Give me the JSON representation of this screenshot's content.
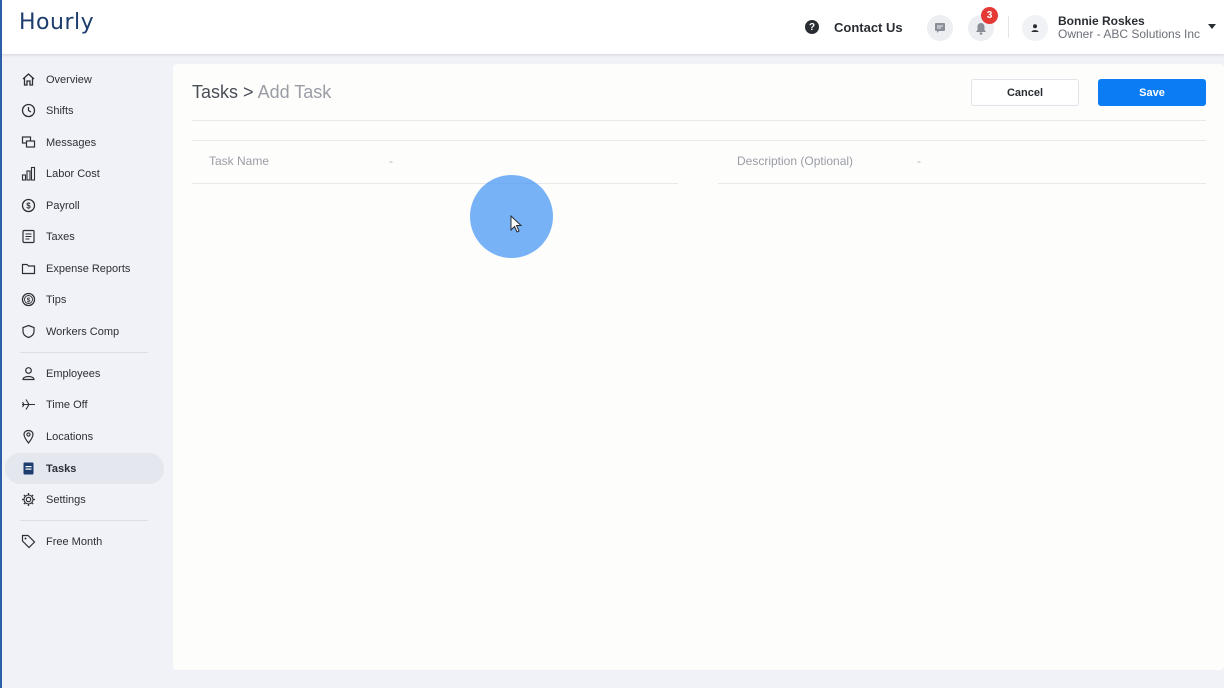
{
  "app": {
    "logo": "Hourly"
  },
  "header": {
    "contact_label": "Contact Us",
    "notification_count": "3",
    "user": {
      "name": "Bonnie Roskes",
      "role": "Owner - ABC Solutions Inc"
    }
  },
  "sidebar": {
    "items": [
      {
        "label": "Overview",
        "icon": "home-icon"
      },
      {
        "label": "Shifts",
        "icon": "clock-icon"
      },
      {
        "label": "Messages",
        "icon": "messages-icon"
      },
      {
        "label": "Labor Cost",
        "icon": "bar-chart-icon"
      },
      {
        "label": "Payroll",
        "icon": "dollar-icon"
      },
      {
        "label": "Taxes",
        "icon": "document-icon"
      },
      {
        "label": "Expense Reports",
        "icon": "folder-icon"
      },
      {
        "label": "Tips",
        "icon": "coin-icon"
      },
      {
        "label": "Workers Comp",
        "icon": "shield-icon"
      },
      {
        "label": "Employees",
        "icon": "person-icon"
      },
      {
        "label": "Time Off",
        "icon": "plane-icon"
      },
      {
        "label": "Locations",
        "icon": "location-pin-icon"
      },
      {
        "label": "Tasks",
        "icon": "book-icon",
        "active": true
      },
      {
        "label": "Settings",
        "icon": "gear-icon"
      },
      {
        "label": "Free Month",
        "icon": "tag-icon"
      }
    ]
  },
  "main": {
    "breadcrumb": {
      "parent": "Tasks",
      "separator": ">",
      "current": "Add Task"
    },
    "cancel_label": "Cancel",
    "save_label": "Save",
    "fields": {
      "task_name": {
        "label": "Task Name",
        "value": "-"
      },
      "description": {
        "label": "Description (Optional)",
        "value": "-"
      }
    }
  },
  "colors": {
    "primary": "#0b7cf3",
    "logo": "#1c3d6e",
    "badge": "#e53935",
    "active_nav_bg": "#e5e7ef",
    "click_indicator": "#4294f5"
  }
}
